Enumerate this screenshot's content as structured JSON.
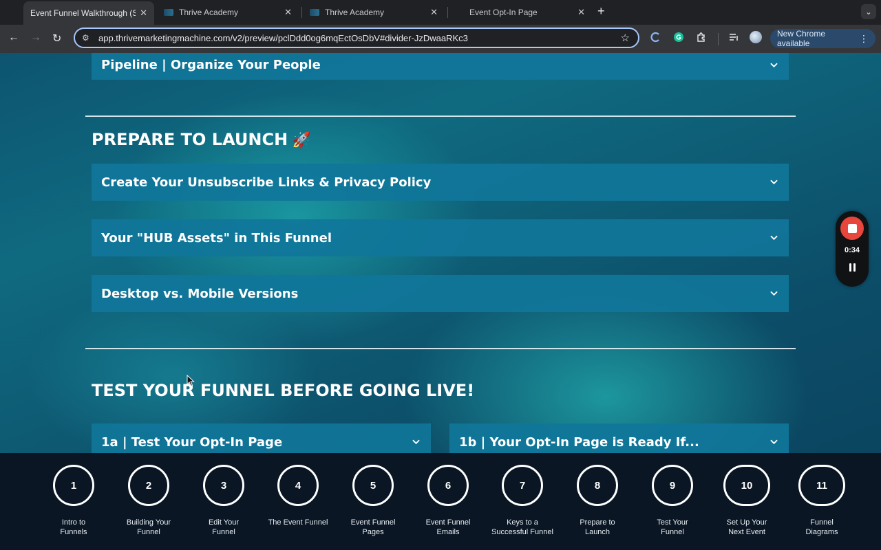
{
  "browser": {
    "tabs": [
      {
        "title": "Event Funnel Walkthrough (S",
        "active": true
      },
      {
        "title": "Thrive Academy",
        "active": false
      },
      {
        "title": "Thrive Academy",
        "active": false
      },
      {
        "title": "Event Opt-In Page",
        "active": false
      }
    ],
    "url": "app.thrivemarketingmachine.com/v2/preview/pclDdd0og6mqEctOsDbV#divider-JzDwaaRKc3",
    "update_label": "New Chrome available"
  },
  "page": {
    "accordions_top": [
      {
        "label": "Pipeline | Organize Your People"
      }
    ],
    "prepare_section": {
      "title": "PREPARE TO LAUNCH",
      "emoji": "🚀",
      "items": [
        {
          "label": "Create Your Unsubscribe Links & Privacy Policy"
        },
        {
          "label": "Your \"HUB Assets\" in This Funnel"
        },
        {
          "label": "Desktop vs. Mobile Versions"
        }
      ]
    },
    "test_section": {
      "title": "TEST YOUR FUNNEL BEFORE GOING LIVE!",
      "items": [
        {
          "label": "1a | Test Your Opt-In Page"
        },
        {
          "label": "1b | Your Opt-In Page is Ready If..."
        }
      ]
    }
  },
  "recorder": {
    "time": "0:34"
  },
  "steps": [
    {
      "number": "1",
      "label_line1": "Intro to",
      "label_line2": "Funnels"
    },
    {
      "number": "2",
      "label_line1": "Building Your",
      "label_line2": "Funnel"
    },
    {
      "number": "3",
      "label_line1": "Edit Your",
      "label_line2": "Funnel"
    },
    {
      "number": "4",
      "label_line1": "The Event Funnel",
      "label_line2": ""
    },
    {
      "number": "5",
      "label_line1": "Event Funnel",
      "label_line2": "Pages"
    },
    {
      "number": "6",
      "label_line1": "Event Funnel",
      "label_line2": "Emails"
    },
    {
      "number": "7",
      "label_line1": "Keys to a",
      "label_line2": "Successful Funnel"
    },
    {
      "number": "8",
      "label_line1": "Prepare to",
      "label_line2": "Launch"
    },
    {
      "number": "9",
      "label_line1": "Test Your",
      "label_line2": "Funnel"
    },
    {
      "number": "10",
      "label_line1": "Set Up Your",
      "label_line2": "Next Event"
    },
    {
      "number": "11",
      "label_line1": "Funnel",
      "label_line2": "Diagrams"
    }
  ],
  "colors": {
    "accordion_bg": "#11759a",
    "stepnav_bg": "#0a1624",
    "record_red": "#e8453c",
    "omnibox_border": "#a8c7fa"
  }
}
